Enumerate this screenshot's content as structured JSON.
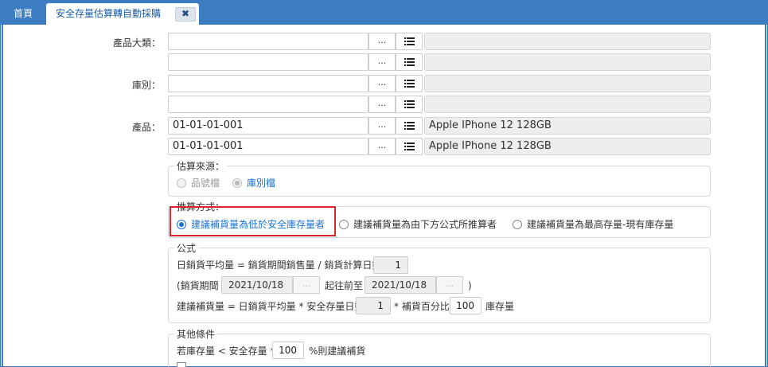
{
  "tabs": {
    "home": "首頁",
    "active": "安全存量估算轉自動採購",
    "close": "✖"
  },
  "fields": {
    "category_label": "產品大類：",
    "warehouse_label": "庫別：",
    "product_label": "產品：",
    "browse": "...",
    "product_from_code": "01-01-01-001",
    "product_to_code": "01-01-01-001",
    "product_from_name": "Apple IPhone 12 128GB",
    "product_to_name": "Apple IPhone 12 128GB"
  },
  "source": {
    "title": "估算來源：",
    "opt_item_file": "品號檔",
    "opt_warehouse_file": "庫別檔"
  },
  "method": {
    "title": "推算方式：",
    "opt1": "建議補貨量為低於安全庫存量者",
    "opt2": "建議補貨量為由下方公式所推算者",
    "opt3": "建議補貨量為最高存量-現有庫存量"
  },
  "formula": {
    "title": "公式",
    "line1": "日銷貨平均量 = 銷貨期間銷售量 / 銷貨計算日數",
    "days_value": "1",
    "period_open": "(銷貨期間",
    "date_from": "2021/10/18",
    "range_text": "起往前至",
    "date_to": "2021/10/18",
    "period_close": ")",
    "line3a": "建議補貨量 = 日銷貨平均量 * 安全存量日數",
    "safety_days": "1",
    "line3b": "* 補貨百分比",
    "percent": "100",
    "line3c": "庫存量"
  },
  "other": {
    "title": "其他條件",
    "cond_a": "若庫存量 < 安全存量 *",
    "cond_value": "100",
    "cond_b": "%則建議補貨"
  }
}
